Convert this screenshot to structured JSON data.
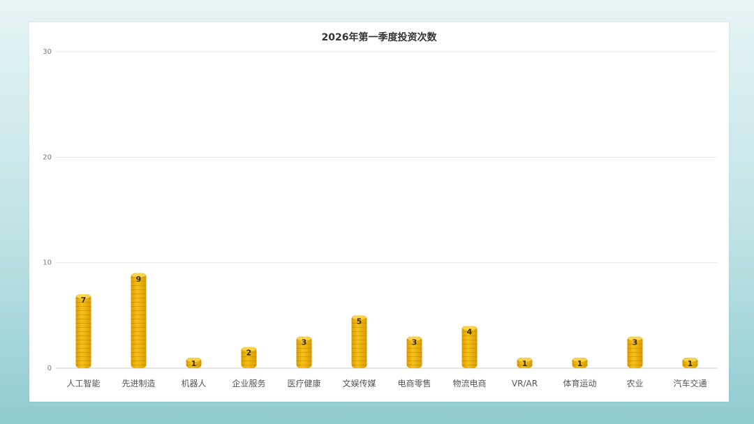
{
  "chart_data": {
    "type": "bar",
    "title": "2026年第一季度投资次数",
    "categories": [
      "人工智能",
      "先进制造",
      "机器人",
      "企业服务",
      "医疗健康",
      "文娱传媒",
      "电商零售",
      "物流电商",
      "VR/AR",
      "体育运动",
      "农业",
      "汽车交通"
    ],
    "values": [
      7,
      9,
      1,
      2,
      3,
      5,
      3,
      4,
      1,
      1,
      3,
      1
    ],
    "yticks": [
      0,
      10,
      20,
      30
    ],
    "ylim": [
      0,
      30
    ],
    "grid": true,
    "bar_color": "#f2b705",
    "bar_color_dark": "#d99a00"
  }
}
